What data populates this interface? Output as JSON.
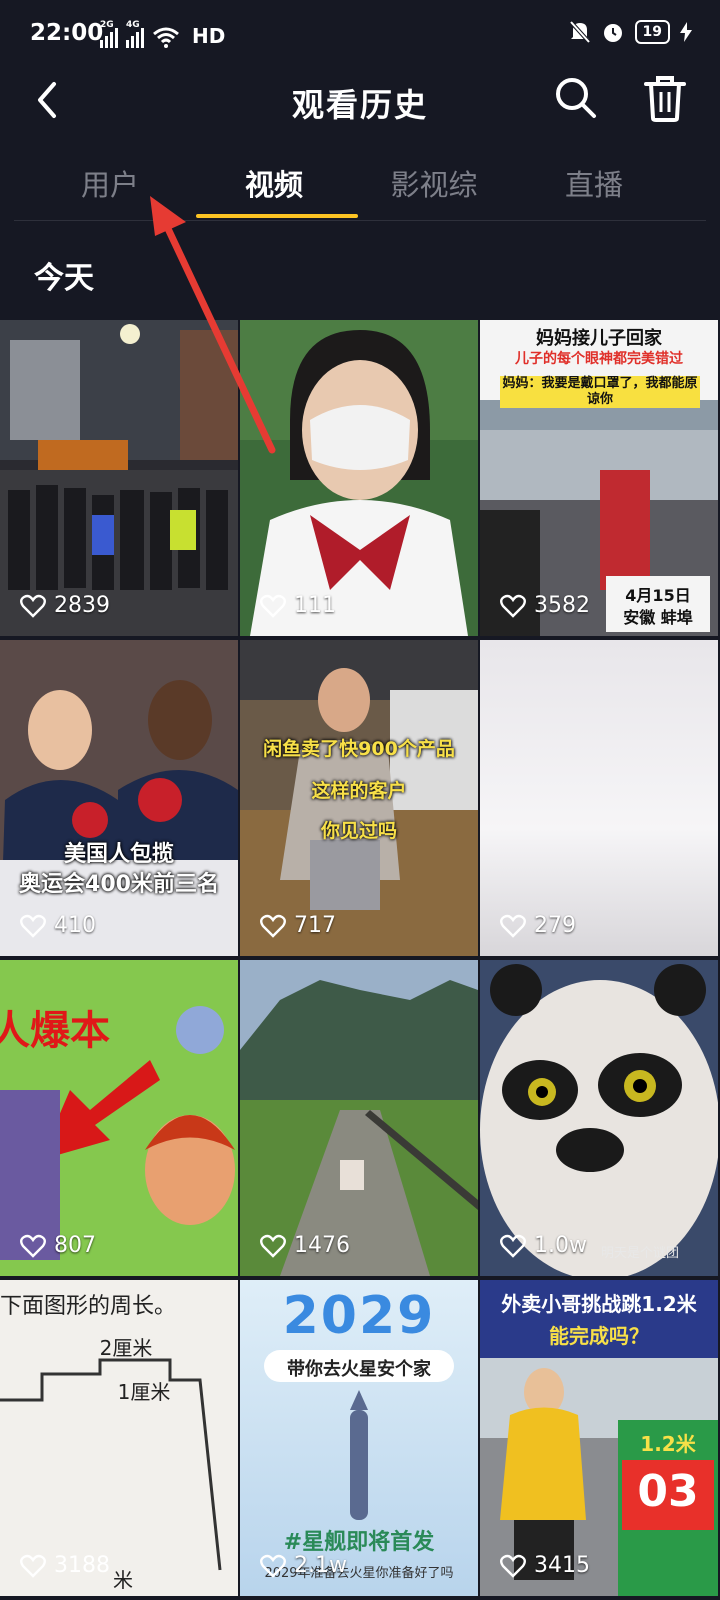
{
  "status": {
    "time": "22:00",
    "net1": "2G",
    "net2": "4G",
    "hd": "HD",
    "battery": "19"
  },
  "header": {
    "title": "观看历史"
  },
  "tabs": [
    {
      "label": "用户"
    },
    {
      "label": "视频"
    },
    {
      "label": "影视综"
    },
    {
      "label": "直播"
    }
  ],
  "section": {
    "title": "今天"
  },
  "videos": [
    {
      "likes": "2839"
    },
    {
      "likes": "111"
    },
    {
      "likes": "3582",
      "caption_top": "妈妈接儿子回家",
      "caption_sub": "儿子的每个眼神都完美错过",
      "caption_quote": "妈妈：我要是戴口罩了，我都能原谅你",
      "caption_date": "4月15日",
      "caption_place": "安徽 蚌埠"
    },
    {
      "likes": "410",
      "caption_1": "美国人包揽",
      "caption_2": "奥运会400米前三名"
    },
    {
      "likes": "717",
      "caption_1": "闲鱼卖了快900个产品",
      "caption_2": "这样的客户",
      "caption_3": "你见过吗"
    },
    {
      "likes": "279"
    },
    {
      "likes": "807",
      "caption_1": "人爆本"
    },
    {
      "likes": "1476"
    },
    {
      "likes": "1.0w",
      "caption_sub": "明天是个谜团"
    },
    {
      "likes": "3188",
      "caption_1": "下面图形的周长。",
      "caption_2": "2厘米",
      "caption_3": "1厘米",
      "caption_4": "米"
    },
    {
      "likes": "2.1w",
      "caption_1": "2029",
      "caption_2": "带你去火星安个家",
      "caption_3": "#星舰即将首发",
      "caption_sub": "2029年准备去火星你准备好了吗"
    },
    {
      "likes": "3415",
      "caption_1": "外卖小哥挑战跳1.2米",
      "caption_2": "能完成吗？",
      "caption_3": "1.2米",
      "caption_4": "03"
    }
  ],
  "colors": {
    "background": "#161823",
    "accent": "#fdc423",
    "inactive_tab": "#7d7f89",
    "annotation_arrow": "#e63b33"
  }
}
